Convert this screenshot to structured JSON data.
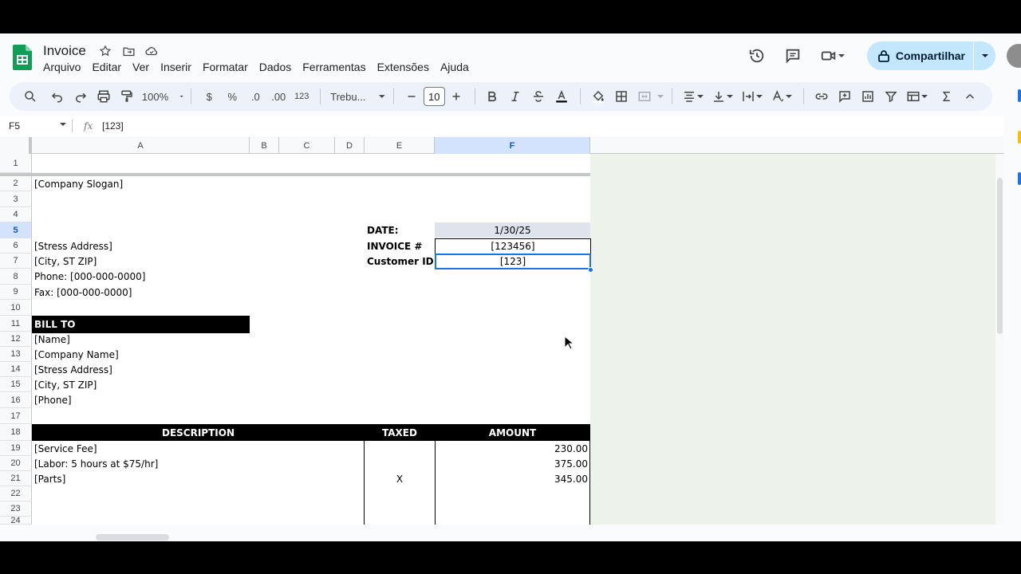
{
  "app": {
    "title": "Invoice",
    "menu": [
      "Arquivo",
      "Editar",
      "Ver",
      "Inserir",
      "Formatar",
      "Dados",
      "Ferramentas",
      "Extensões",
      "Ajuda"
    ],
    "share_label": "Compartilhar"
  },
  "toolbar": {
    "zoom": "100%",
    "currency": "$",
    "percent": "%",
    "dec_decrease": ".0",
    "dec_increase": ".00",
    "number_format": "123",
    "font": "Trebu...",
    "font_size": "10"
  },
  "formula_bar": {
    "cell_ref": "F5",
    "fx": "fx",
    "value": "[123]"
  },
  "columns": [
    "A",
    "B",
    "C",
    "D",
    "E",
    "F"
  ],
  "rows": [
    "1",
    "2",
    "3",
    "4",
    "5",
    "6",
    "7",
    "8",
    "9",
    "10",
    "11",
    "12",
    "13",
    "14",
    "15",
    "16",
    "17",
    "18",
    "19",
    "20",
    "21",
    "22",
    "23",
    "24"
  ],
  "invoice": {
    "slogan": "[Company Slogan]",
    "address": "[Stress Address]",
    "city": "[City, ST  ZIP]",
    "phone": "Phone: [000-000-0000]",
    "fax": "Fax: [000-000-0000]",
    "date_label": "DATE:",
    "date_value": "1/30/25",
    "invoice_label": "INVOICE #",
    "invoice_value": "[123456]",
    "customer_label": "Customer ID",
    "customer_value": "[123]",
    "bill_to": "BILL TO",
    "bill_name": "[Name]",
    "bill_company": "[Company Name]",
    "bill_address": "[Stress Address]",
    "bill_city": "[City, ST  ZIP]",
    "bill_phone": "[Phone]",
    "hdr_description": "DESCRIPTION",
    "hdr_taxed": "TAXED",
    "hdr_amount": "AMOUNT",
    "items": [
      {
        "description": "[Service Fee]",
        "taxed": "",
        "amount": "230.00"
      },
      {
        "description": "[Labor: 5 hours at $75/hr]",
        "taxed": "",
        "amount": "375.00"
      },
      {
        "description": "[Parts]",
        "taxed": "X",
        "amount": "345.00"
      }
    ]
  }
}
